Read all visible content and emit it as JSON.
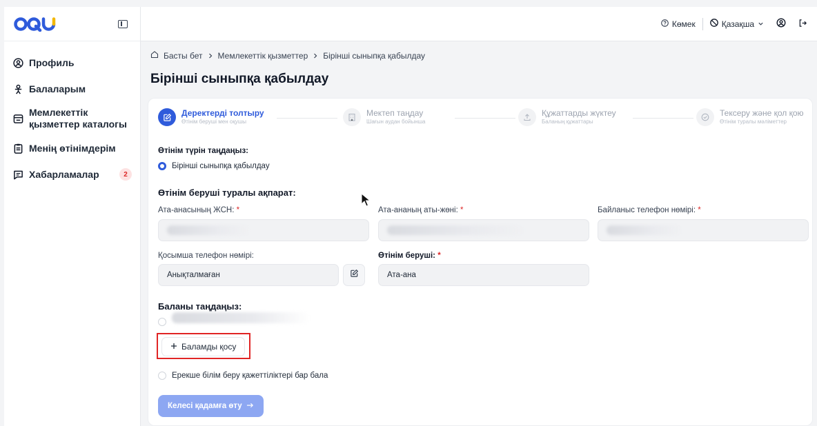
{
  "brand": {
    "logo_text": "OQU"
  },
  "topbar": {
    "help_label": "Көмек",
    "language_label": "Қазақша"
  },
  "sidebar": {
    "items": [
      {
        "label": "Профиль",
        "icon": "user-circle-icon"
      },
      {
        "label": "Балаларым",
        "icon": "children-icon"
      },
      {
        "label_line1": "Мемлекеттік",
        "label_line2": "қызметтер каталогы",
        "icon": "catalog-icon"
      },
      {
        "label": "Менің өтінімдерім",
        "icon": "clipboard-icon"
      },
      {
        "label": "Хабарламалар",
        "icon": "message-icon",
        "badge": "2"
      }
    ]
  },
  "breadcrumb": {
    "home": "Басты бет",
    "level1": "Мемлекеттік қызметтер",
    "level2": "Бірінші сыныпқа қабылдау"
  },
  "page_title": "Бірінші сыныпқа қабылдау",
  "stepper": [
    {
      "title": "Деректерді толтыру",
      "sub": "Өтінім беруші мен оқушы"
    },
    {
      "title": "Мектеп таңдау",
      "sub": "Шағын аудан бойынша"
    },
    {
      "title": "Құжаттарды жүктеу",
      "sub": "Баланың құжаттары"
    },
    {
      "title": "Тексеру және қол қою",
      "sub": "Өтінім туралы мәліметтер"
    }
  ],
  "form": {
    "application_type_label": "Өтінім түрін таңдаңыз:",
    "application_type_option": "Бірінші сыныпқа қабылдау",
    "applicant_section": "Өтінім беруші туралы ақпарат:",
    "iin_label": "Ата-анасының ЖСН:",
    "parent_name_label": "Ата-ананың аты-жөні:",
    "phone_label": "Байланыс телефон нөмірі:",
    "extra_phone_label": "Қосымша телефон нөмірі:",
    "extra_phone_value": "Анықталмаған",
    "applicant_label": "Өтінім беруші:",
    "applicant_value": "Ата-ана",
    "required_mark": "*",
    "choose_child_label": "Баланы таңдаңыз:",
    "add_child_label": "Баламды қосу",
    "special_needs_label": "Ерекше білім беру қажеттіліктері бар бала",
    "next_label": "Келесі қадамға өту"
  },
  "colors": {
    "accent": "#2f5bdb",
    "next_button": "#8da7f2",
    "highlight_box": "#e02424",
    "badge": "#dc2626"
  }
}
